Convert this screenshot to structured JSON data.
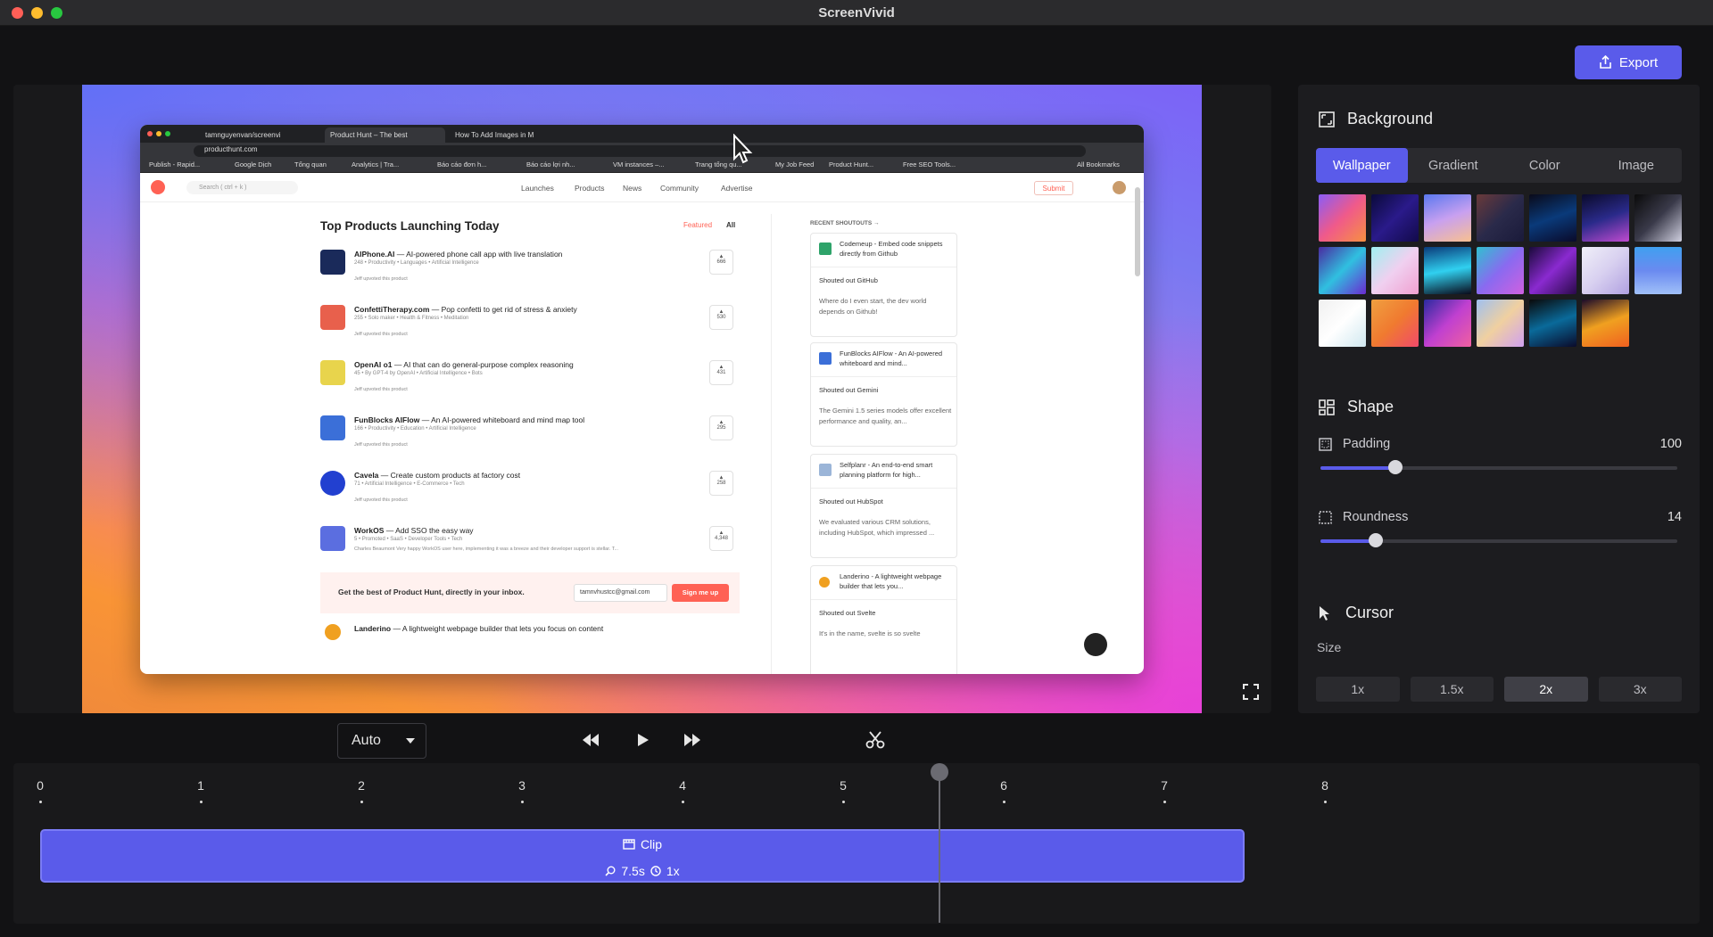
{
  "app": {
    "title": "ScreenVivid",
    "export_label": "Export"
  },
  "window_controls": {
    "close_color": "#ff5f57",
    "min_color": "#febc2e",
    "max_color": "#28c840"
  },
  "preview": {
    "browser": {
      "tabs": [
        "tamnguyenvan/screenvi",
        "Product Hunt – The best",
        "How To Add Images in M"
      ],
      "url": "producthunt.com",
      "bookmarks": [
        "Publish - Rapid...",
        "Google Dịch",
        "Tổng quan",
        "Analytics | Tra...",
        "Báo cáo đơn h...",
        "Báo cáo lợi nh...",
        "VM instances –...",
        "Trang tổng qu...",
        "My Job Feed",
        "Product Hunt...",
        "Free SEO Tools..."
      ],
      "all_bookmarks": "All Bookmarks"
    },
    "page": {
      "search_placeholder": "Search ( ctrl + k )",
      "nav": [
        "Launches",
        "Products",
        "News",
        "Community",
        "Advertise"
      ],
      "submit": "Submit",
      "heading": "Top Products Launching Today",
      "filter_featured": "Featured",
      "filter_all": "All",
      "products": [
        {
          "name": "AIPhone.AI",
          "tagline": " — AI-powered phone call app with live translation",
          "meta": "248 • Productivity • Languages • Artificial Intelligence",
          "upvote": "Jeff upvoted this product",
          "votes": "666",
          "color": "#1a2a5a"
        },
        {
          "name": "ConfettiTherapy.com",
          "tagline": " — Pop confetti to get rid of stress & anxiety",
          "meta": "255 • Solo maker • Health & Fitness • Meditation",
          "upvote": "Jeff upvoted this product",
          "votes": "530",
          "color": "#e8604c"
        },
        {
          "name": "OpenAI o1",
          "tagline": " — AI that can do general-purpose complex reasoning",
          "meta": "45 • By GPT-4 by OpenAI • Artificial Intelligence • Bots",
          "upvote": "Jeff upvoted this product",
          "votes": "431",
          "color": "#e8d44c"
        },
        {
          "name": "FunBlocks AIFlow",
          "tagline": " — An AI-powered whiteboard and mind map tool",
          "meta": "166 • Productivity • Education • Artificial Intelligence",
          "upvote": "Jeff upvoted this product",
          "votes": "295",
          "color": "#3b6fd8"
        },
        {
          "name": "Cavela",
          "tagline": " — Create custom products at factory cost",
          "meta": "71 • Artificial Intelligence • E-Commerce • Tech",
          "upvote": "Jeff upvoted this product",
          "votes": "258",
          "color": "#2240d0"
        },
        {
          "name": "WorkOS",
          "tagline": " — Add SSO the easy way",
          "meta": "5 • Promoted • SaaS • Developer Tools • Tech",
          "upvote": "Charles Beaumont Very happy WorkOS user here, implementing it was a breeze and their developer support is stellar. T...",
          "votes": "4,348",
          "color": "#5b6ee0"
        }
      ],
      "newsletter": {
        "text": "Get the best of Product Hunt, directly in your inbox.",
        "email": "tamnvhustcc@gmail.com",
        "button": "Sign me up"
      },
      "last_product": {
        "name": "Landerino",
        "tagline": " — A lightweight webpage builder that lets you focus on content"
      },
      "shoutouts_title": "RECENT SHOUTOUTS →",
      "shoutouts": [
        {
          "title": "Codemeup - Embed code snippets directly from Github",
          "by": "Shouted out  GitHub",
          "desc": "Where do I even start, the dev world depends on Github!"
        },
        {
          "title": "FunBlocks AIFlow - An AI-powered whiteboard and mind...",
          "by": "Shouted out  Gemini",
          "desc": "The Gemini 1.5 series models offer excellent performance and quality, an..."
        },
        {
          "title": "Selfplanr - An end-to-end smart planning platform for high...",
          "by": "Shouted out  HubSpot",
          "desc": "We evaluated various CRM solutions, including HubSpot, which impressed ..."
        },
        {
          "title": "Landerino - A lightweight webpage builder that lets you...",
          "by": "Shouted out  Svelte",
          "desc": "It's in the name, svelte is so svelte"
        }
      ]
    }
  },
  "panel": {
    "background": {
      "title": "Background",
      "tabs": [
        "Wallpaper",
        "Gradient",
        "Color",
        "Image"
      ],
      "active_tab": "Wallpaper"
    },
    "shape": {
      "title": "Shape",
      "padding_label": "Padding",
      "padding_value": "100",
      "padding_fraction": 0.21,
      "roundness_label": "Roundness",
      "roundness_value": "14",
      "roundness_fraction": 0.155
    },
    "cursor": {
      "title": "Cursor",
      "size_label": "Size",
      "sizes": [
        "1x",
        "1.5x",
        "2x",
        "3x"
      ],
      "active_size": "2x"
    }
  },
  "controls": {
    "mode": "Auto"
  },
  "timeline": {
    "ticks": [
      "0",
      "1",
      "2",
      "3",
      "4",
      "5",
      "6",
      "7",
      "8"
    ],
    "clip_label": "Clip",
    "clip_duration": "7.5s",
    "clip_speed": "1x",
    "playhead_seconds": 5.6
  }
}
